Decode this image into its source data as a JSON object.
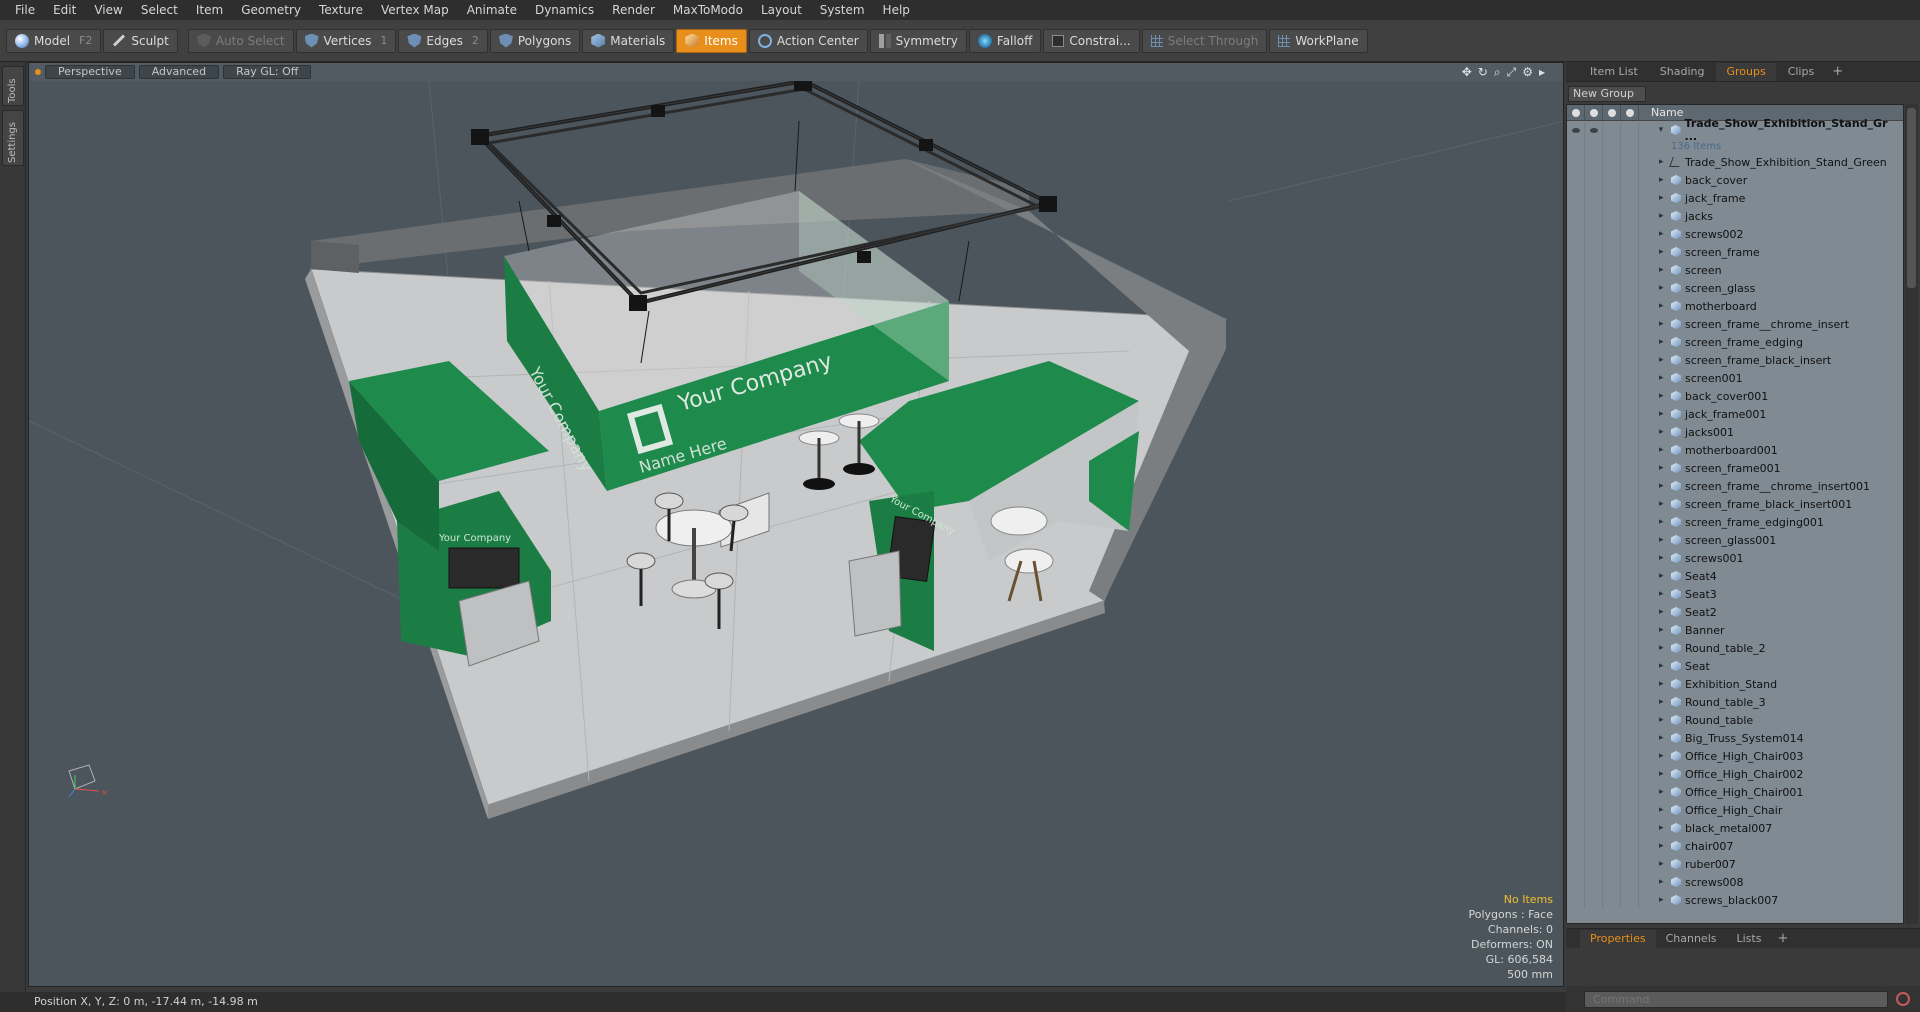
{
  "menu": [
    "File",
    "Edit",
    "View",
    "Select",
    "Item",
    "Geometry",
    "Texture",
    "Vertex Map",
    "Animate",
    "Dynamics",
    "Render",
    "MaxToModo",
    "Layout",
    "System",
    "Help"
  ],
  "toolbar": {
    "model": "Model",
    "model_key": "F2",
    "sculpt": "Sculpt",
    "auto_select": "Auto Select",
    "vertices": "Vertices",
    "vertices_key": "1",
    "edges": "Edges",
    "edges_key": "2",
    "polygons": "Polygons",
    "materials": "Materials",
    "items": "Items",
    "action_center": "Action Center",
    "symmetry": "Symmetry",
    "falloff": "Falloff",
    "constraints": "Constrai...",
    "select_through": "Select Through",
    "workplane": "WorkPlane"
  },
  "left_tabs": {
    "tools": "Tools",
    "settings": "Settings"
  },
  "viewport": {
    "tabs": [
      "Perspective",
      "Advanced",
      "Ray GL: Off"
    ],
    "banner_company": "Your Company",
    "banner_name": "Name Here",
    "info": {
      "no_items": "No Items",
      "polygons": "Polygons : Face",
      "channels": "Channels: 0",
      "deformers": "Deformers: ON",
      "gl": "GL: 606,584",
      "scale": "500 mm"
    }
  },
  "right_panel": {
    "tabs": [
      "Item List",
      "Shading",
      "Groups",
      "Clips"
    ],
    "active_tab": "Groups",
    "new_group": "New Group",
    "column_name": "Name",
    "root": {
      "name": "Trade_Show_Exhibition_Stand_Gr ...",
      "count": "136 Items"
    },
    "items": [
      "Trade_Show_Exhibition_Stand_Green",
      "back_cover",
      "jack_frame",
      "jacks",
      "screws002",
      "screen_frame",
      "screen",
      "screen_glass",
      "motherboard",
      "screen_frame__chrome_insert",
      "screen_frame_edging",
      "screen_frame_black_insert",
      "screen001",
      "back_cover001",
      "jack_frame001",
      "jacks001",
      "motherboard001",
      "screen_frame001",
      "screen_frame__chrome_insert001",
      "screen_frame_black_insert001",
      "screen_frame_edging001",
      "screen_glass001",
      "screws001",
      "Seat4",
      "Seat3",
      "Seat2",
      "Banner",
      "Round_table_2",
      "Seat",
      "Exhibition_Stand",
      "Round_table_3",
      "Round_table",
      "Big_Truss_System014",
      "Office_High_Chair003",
      "Office_High_Chair002",
      "Office_High_Chair001",
      "Office_High_Chair",
      "black_metal007",
      "chair007",
      "ruber007",
      "screws008",
      "screws_black007"
    ],
    "bottom_tabs": [
      "Properties",
      "Channels",
      "Lists"
    ],
    "command_placeholder": "Command"
  },
  "status": {
    "position": "Position X, Y, Z:   0 m, -17.44 m, -14.98 m"
  },
  "colors": {
    "accent": "#e88f1b",
    "booth_green": "#1e8a4b",
    "viewport_bg": "#4c555c"
  }
}
